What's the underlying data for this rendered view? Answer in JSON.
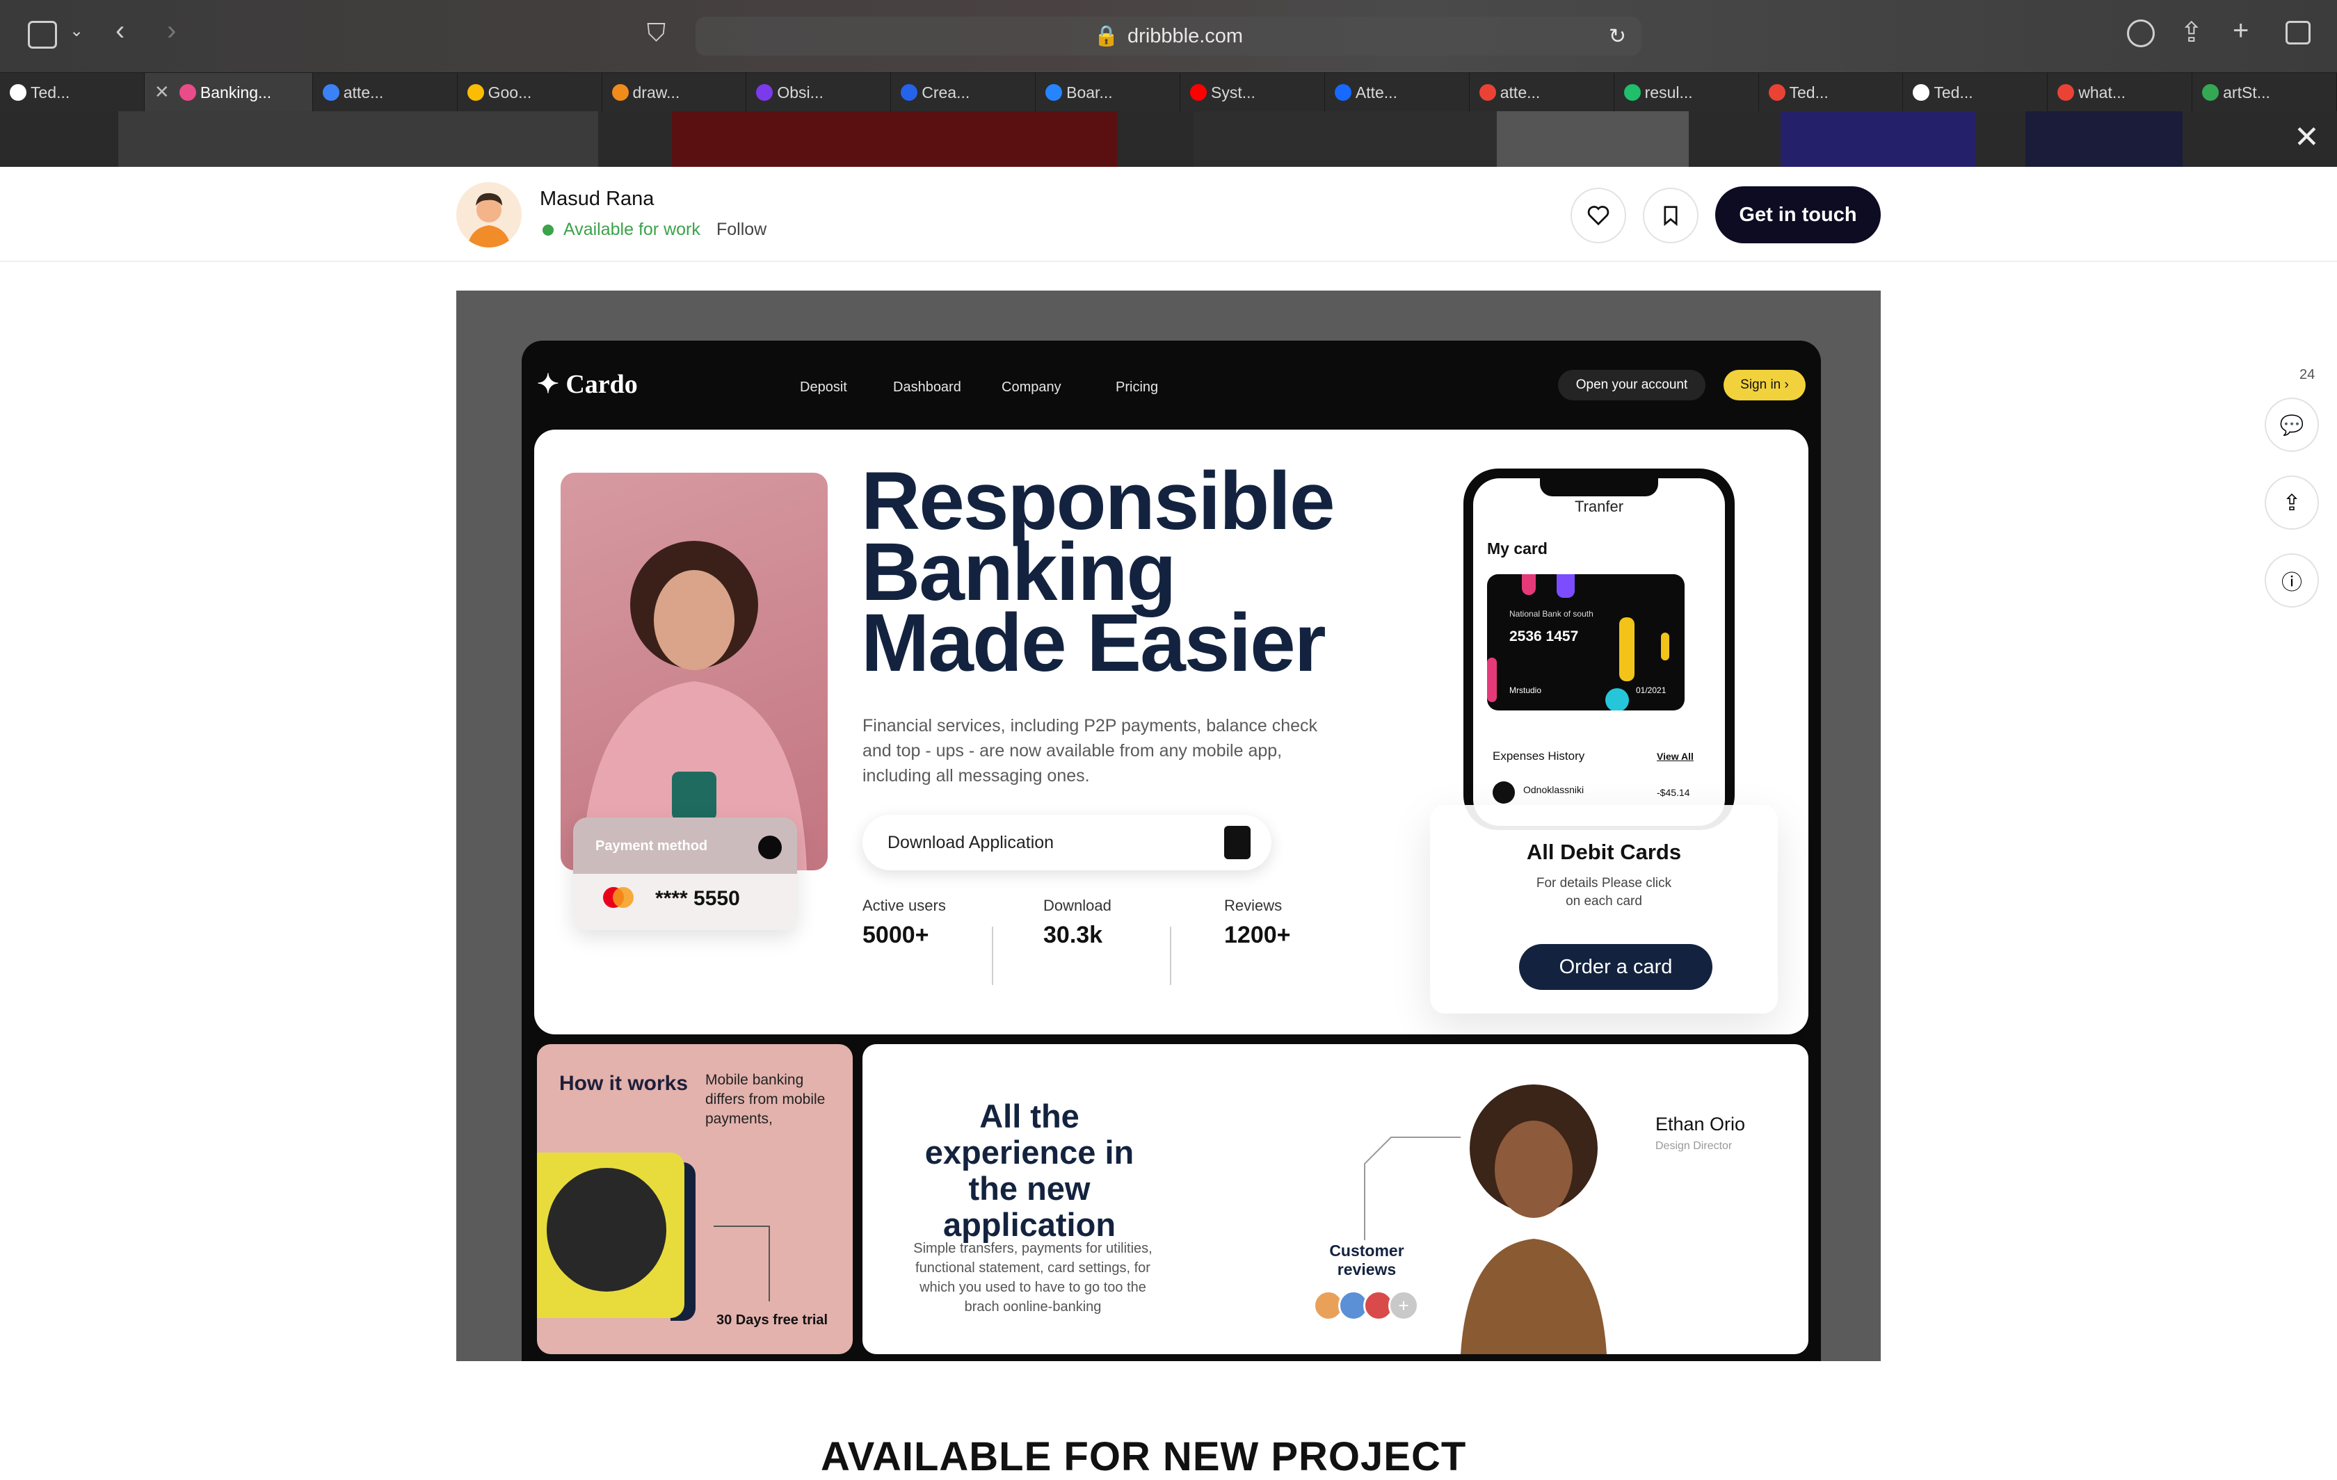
{
  "browser": {
    "url": "dribbble.com",
    "tabs": [
      {
        "label": "Ted...",
        "color": "#ffffff"
      },
      {
        "label": "Banking...",
        "color": "#ea4c89",
        "active": true
      },
      {
        "label": "atte...",
        "color": "#3b82f6"
      },
      {
        "label": "Goo...",
        "color": "#fbbc04"
      },
      {
        "label": "draw...",
        "color": "#f08c1b"
      },
      {
        "label": "Obsi...",
        "color": "#7c3aed"
      },
      {
        "label": "Crea...",
        "color": "#2563eb"
      },
      {
        "label": "Boar...",
        "color": "#2684ff"
      },
      {
        "label": "Syst...",
        "color": "#ff0000"
      },
      {
        "label": "Atte...",
        "color": "#1769ff"
      },
      {
        "label": "atte...",
        "color": "#ea4335"
      },
      {
        "label": "resul...",
        "color": "#1fbf6b"
      },
      {
        "label": "Ted...",
        "color": "#ea4335"
      },
      {
        "label": "Ted...",
        "color": "#ffffff"
      },
      {
        "label": "what...",
        "color": "#ea4335"
      },
      {
        "label": "artSt...",
        "color": "#34a853"
      }
    ]
  },
  "header": {
    "name": "Masud Rana",
    "availability": "Available for work",
    "follow": "Follow",
    "cta": "Get in touch",
    "comment_count": "24"
  },
  "site": {
    "logo": "✦ Cardo",
    "nav": [
      "Deposit",
      "Dashboard",
      "Company",
      "Pricing"
    ],
    "open_account": "Open your account",
    "sign_in": "Sign in ›",
    "headline": "Responsible Banking Made Easier",
    "subtext": "Financial services, including P2P payments, balance check and top - ups - are now available from any mobile app, including all messaging ones.",
    "download": "Download Application",
    "payment": {
      "title": "Payment method",
      "number": "**** 5550"
    },
    "stats": [
      {
        "label": "Active users",
        "value": "5000+"
      },
      {
        "label": "Download",
        "value": "30.3k"
      },
      {
        "label": "Reviews",
        "value": "1200+"
      }
    ],
    "phone": {
      "title": "Tranfer",
      "my_card": "My card",
      "bank": "National Bank of south",
      "card_number": "2536 1457",
      "holder": "Mrstudio",
      "expiry": "01/2021",
      "expenses": "Expenses History",
      "view_all": "View All",
      "row_name": "Odnoklassniki",
      "row_amount": "-$45.14"
    },
    "debit": {
      "title": "All Debit Cards",
      "subtitle": "For details Please click on each card",
      "button": "Order a card"
    },
    "how": {
      "title": "How it works",
      "desc": "Mobile banking differs from mobile payments,",
      "trial": "30 Days free trial"
    },
    "experience": {
      "title": "All the experience in the new application",
      "desc": "Simple transfers, payments for utilities, functional statement, card settings, for which you used to have to go too the brach oonline-banking",
      "reviews": "Customer reviews",
      "person": "Ethan Orio",
      "role": "Design Director"
    }
  },
  "below": "AVAILABLE FOR NEW PROJECT"
}
